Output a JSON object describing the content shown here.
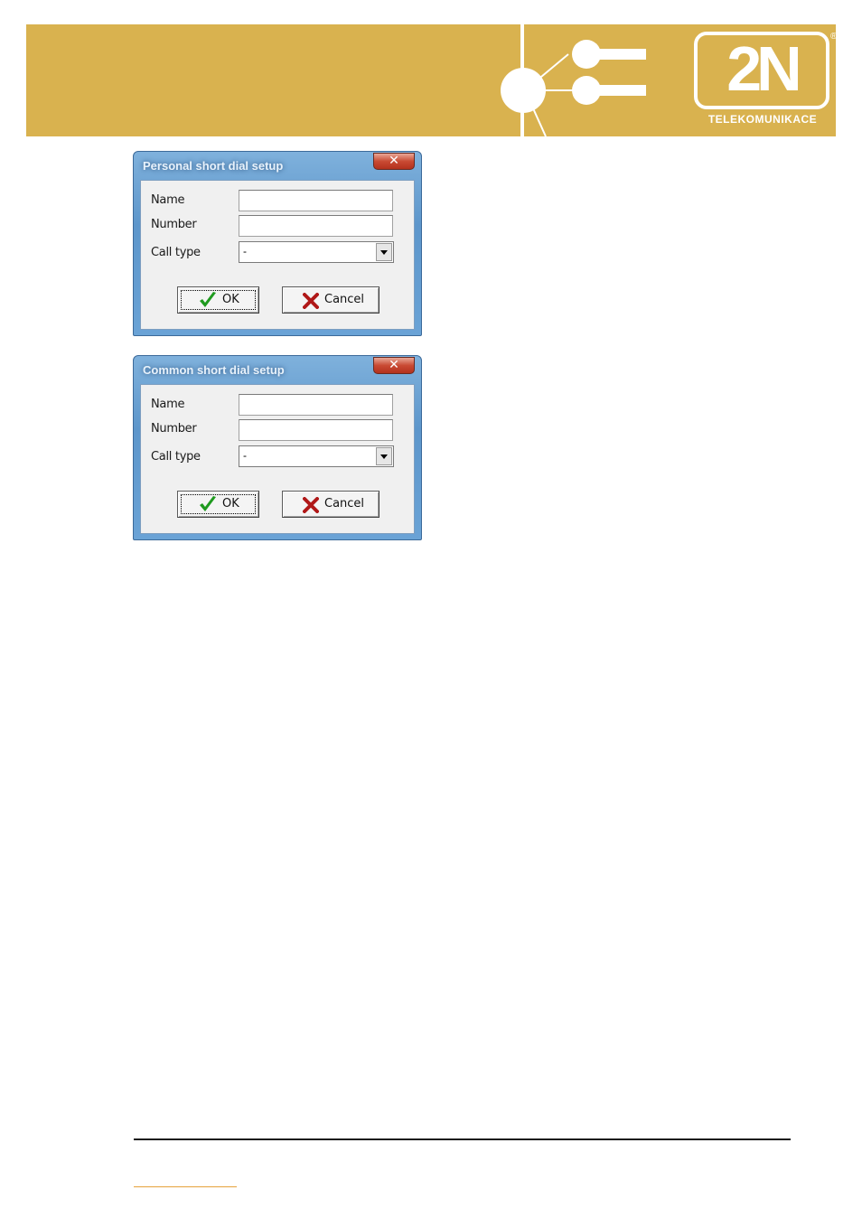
{
  "brand": {
    "logo_text": "2N",
    "tagline": "TELEKOMUNIKACE",
    "registered": "®",
    "banner_color": "#d9b24f"
  },
  "dialogs": [
    {
      "title": "Personal short dial setup",
      "close_icon": "close-icon",
      "fields": {
        "name_label": "Name",
        "name_value": "",
        "number_label": "Number",
        "number_value": "",
        "call_type_label": "Call type",
        "call_type_value": "-"
      },
      "buttons": {
        "ok_label": "OK",
        "cancel_label": "Cancel"
      }
    },
    {
      "title": "Common short dial setup",
      "close_icon": "close-icon",
      "fields": {
        "name_label": "Name",
        "name_value": "",
        "number_label": "Number",
        "number_value": "",
        "call_type_label": "Call type",
        "call_type_value": "-"
      },
      "buttons": {
        "ok_label": "OK",
        "cancel_label": "Cancel"
      }
    }
  ],
  "icons": {
    "ok": "check-icon",
    "cancel": "cross-icon",
    "dropdown": "chevron-down-icon"
  },
  "colors": {
    "ok_check": "#1f9a1f",
    "cancel_cross": "#b01818",
    "footer_link": "#e6a23b"
  }
}
